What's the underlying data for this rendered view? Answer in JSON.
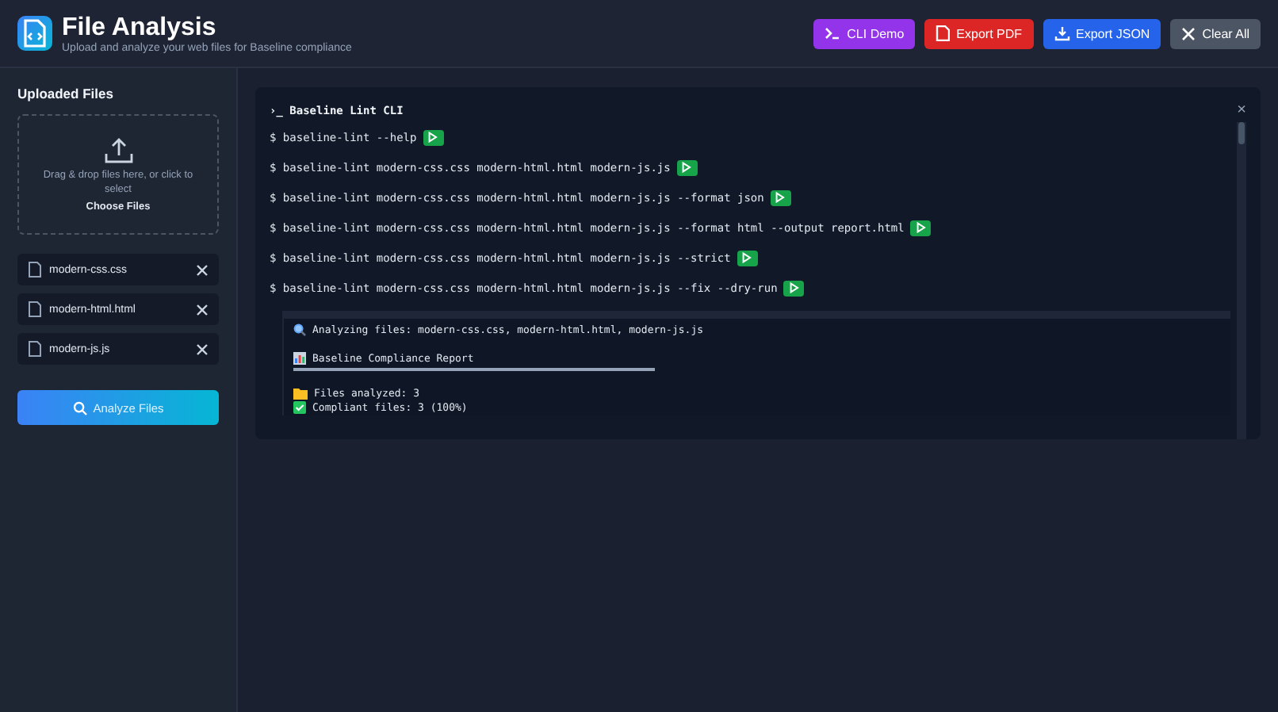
{
  "header": {
    "title": "File Analysis",
    "subtitle": "Upload and analyze your web files for Baseline compliance"
  },
  "actions": [
    {
      "kind": "cli",
      "label": "CLI Demo"
    },
    {
      "kind": "pdf",
      "label": "Export PDF"
    },
    {
      "kind": "json",
      "label": "Export JSON"
    },
    {
      "kind": "clear",
      "label": "Clear All"
    }
  ],
  "sidebar": {
    "title": "Uploaded Files",
    "dropzone": {
      "text": "Drag & drop files here, or click to select",
      "button": "Choose Files"
    },
    "files": [
      {
        "name": "modern-css.css"
      },
      {
        "name": "modern-html.html"
      },
      {
        "name": "modern-js.js"
      }
    ],
    "analyze_button": "Analyze Files"
  },
  "terminal": {
    "prompt_icon": "›_",
    "title": "Baseline Lint CLI",
    "close": "×",
    "commands": [
      {
        "prompt": "$",
        "text": "baseline-lint --help"
      },
      {
        "prompt": "$",
        "text": "baseline-lint modern-css.css modern-html.html modern-js.js"
      },
      {
        "prompt": "$",
        "text": "baseline-lint modern-css.css modern-html.html modern-js.js --format json"
      },
      {
        "prompt": "$",
        "text": "baseline-lint modern-css.css modern-html.html modern-js.js --format html --output report.html"
      },
      {
        "prompt": "$",
        "text": "baseline-lint modern-css.css modern-html.html modern-js.js --strict"
      },
      {
        "prompt": "$",
        "text": "baseline-lint modern-css.css modern-html.html modern-js.js --fix --dry-run"
      }
    ],
    "output": [
      {
        "kind": "search",
        "text": "Analyzing files: modern-css.css, modern-html.html, modern-js.js"
      },
      {
        "kind": "chart",
        "text": "Baseline Compliance Report"
      },
      {
        "kind": "rule"
      },
      {
        "kind": "folder",
        "text": "Files analyzed: 3"
      },
      {
        "kind": "check",
        "text": "Compliant files: 3 (100%)"
      }
    ]
  }
}
